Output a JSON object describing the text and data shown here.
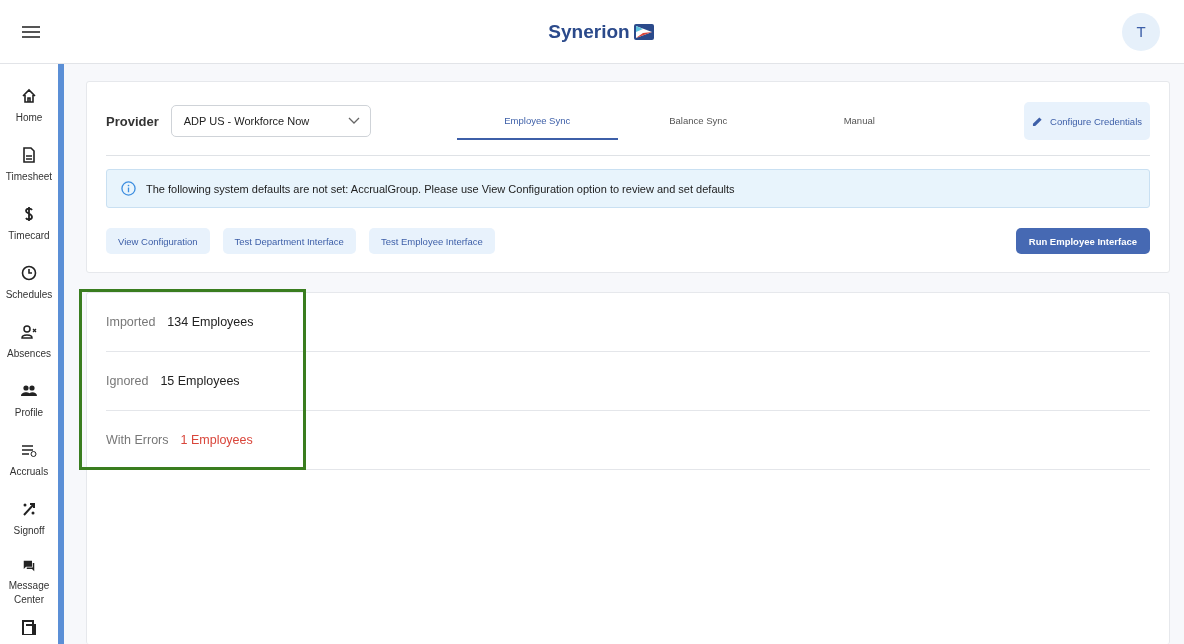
{
  "header": {
    "logo": "Synerion",
    "avatar": "T"
  },
  "sidebar": {
    "items": [
      {
        "kind": "home",
        "label": "Home"
      },
      {
        "kind": "timesheet",
        "label": "Timesheet"
      },
      {
        "kind": "timecard",
        "label": "Timecard"
      },
      {
        "kind": "schedules",
        "label": "Schedules"
      },
      {
        "kind": "absences",
        "label": "Absences"
      },
      {
        "kind": "profile",
        "label": "Profile"
      },
      {
        "kind": "accruals",
        "label": "Accruals"
      },
      {
        "kind": "signoff",
        "label": "Signoff"
      },
      {
        "kind": "messages",
        "label": "Message Center"
      },
      {
        "kind": "document"
      }
    ]
  },
  "provider": {
    "label": "Provider",
    "value": "ADP US - Workforce Now"
  },
  "tabs": [
    {
      "label": "Employee Sync",
      "selected": true
    },
    {
      "label": "Balance Sync",
      "selected": false
    },
    {
      "label": "Manual",
      "selected": false
    }
  ],
  "configure_button": "Configure Credentials",
  "alert": "The following system defaults are not set: AccrualGroup. Please use View Configuration option to review and set defaults",
  "actions": [
    "View Configuration",
    "Test Department Interface",
    "Test Employee Interface"
  ],
  "run_button": "Run Employee Interface",
  "summary": {
    "highlighted": true,
    "stats": [
      {
        "label": "Imported",
        "value": "134 Employees",
        "kind": "normal"
      },
      {
        "label": "Ignored",
        "value": "15 Employees",
        "kind": "normal"
      },
      {
        "label": "With Errors",
        "value": "1 Employees",
        "kind": "error"
      }
    ]
  }
}
